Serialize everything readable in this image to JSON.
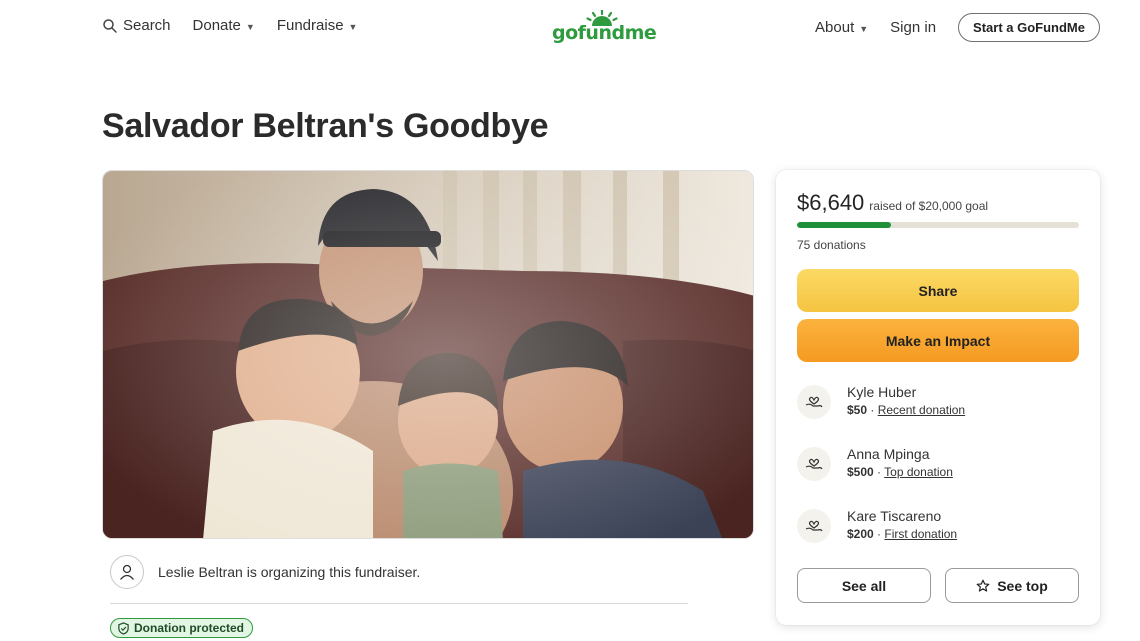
{
  "nav": {
    "search_label": "Search",
    "donate_label": "Donate",
    "fundraise_label": "Fundraise",
    "about_label": "About",
    "signin_label": "Sign in",
    "start_label": "Start a GoFundMe"
  },
  "logo": {
    "text": "gofundme",
    "color": "#2e9b3e"
  },
  "campaign": {
    "title": "Salvador Beltran's Goodbye",
    "organizer_text": "Leslie Beltran is organizing this fundraiser.",
    "protected_label": "Donation protected"
  },
  "donation_card": {
    "raised_amount": "$6,640",
    "goal_text": "raised of $20,000 goal",
    "progress_fraction": 0.332,
    "donations_count": "75 donations",
    "share_label": "Share",
    "impact_label": "Make an Impact",
    "donors": [
      {
        "name": "Kyle Huber",
        "amount": "$50",
        "separator": " · ",
        "type": "Recent donation"
      },
      {
        "name": "Anna Mpinga",
        "amount": "$500",
        "separator": " · ",
        "type": "Top donation"
      },
      {
        "name": "Kare Tiscareno",
        "amount": "$200",
        "separator": " · ",
        "type": "First donation"
      }
    ],
    "see_all_label": "See all",
    "see_top_label": "See top"
  },
  "colors": {
    "brand_green": "#2e9b3e",
    "progress_fill": "#1f8f3a",
    "share_button": "#f5c441",
    "impact_button": "#f59a22"
  },
  "icons": {
    "search": "search-icon",
    "caret": "chevron-down-icon",
    "organizer": "user-icon",
    "shield": "shield-check-icon",
    "donor": "heart-hands-icon",
    "star": "star-icon"
  }
}
